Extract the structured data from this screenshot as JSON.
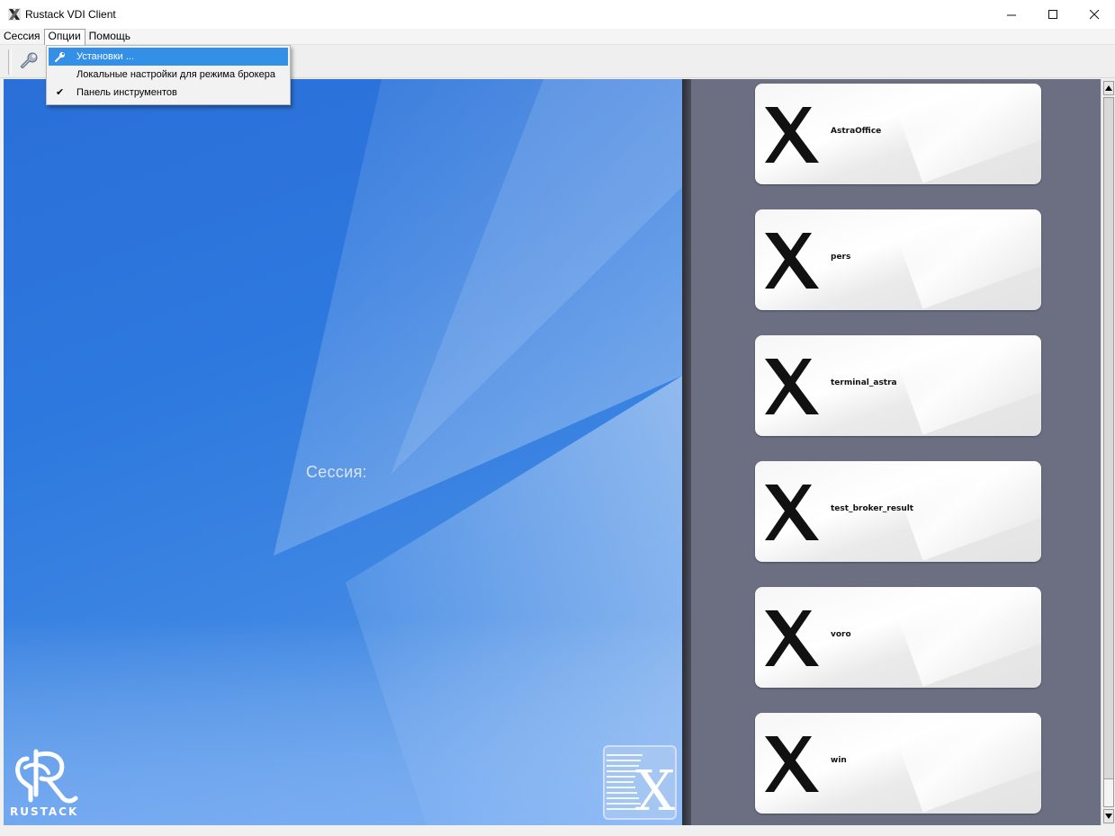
{
  "window": {
    "title": "Rustack VDI Client",
    "controls": {
      "minimize": "–",
      "maximize": "☐",
      "close": "✕"
    }
  },
  "menubar": {
    "items": [
      {
        "label": "Сессия"
      },
      {
        "label": "Опции"
      },
      {
        "label": "Помощь"
      }
    ]
  },
  "dropdown": {
    "items": [
      {
        "label": "Установки ...",
        "icon": "wrench-icon"
      },
      {
        "label": "Локальные настройки для режима брокера"
      },
      {
        "label": "Панель инструментов",
        "checked": "✔"
      }
    ]
  },
  "main": {
    "session_label": "Сессия:",
    "logo_text": "RUSTACK"
  },
  "sessions": [
    {
      "name": "AstraOffice"
    },
    {
      "name": "pers"
    },
    {
      "name": "terminal_astra"
    },
    {
      "name": "test_broker_result"
    },
    {
      "name": "voro"
    },
    {
      "name": "win"
    }
  ],
  "colors": {
    "accent": "#3390e6",
    "panel_blue": "#2d78de",
    "sessions_bg": "#6c6e82"
  }
}
